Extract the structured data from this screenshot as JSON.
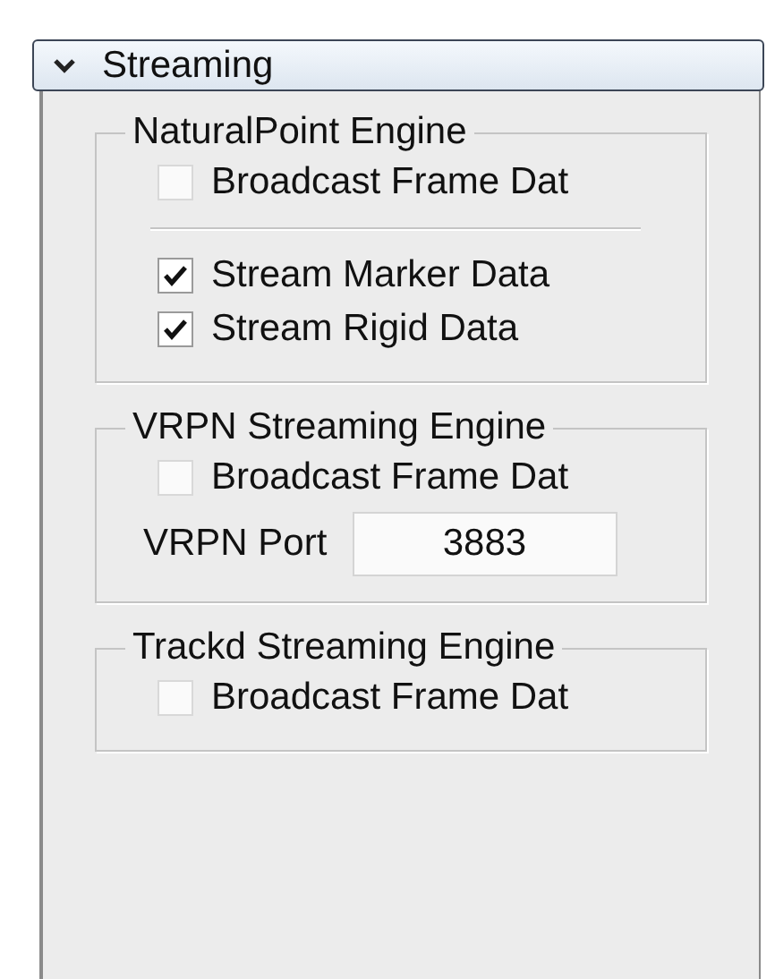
{
  "section": {
    "title": "Streaming",
    "expanded": true,
    "groups": [
      {
        "title": "NaturalPoint Engine",
        "items": [
          {
            "kind": "checkbox",
            "label": "Broadcast Frame Dat",
            "checked": false
          },
          {
            "kind": "separator"
          },
          {
            "kind": "checkbox",
            "label": "Stream Marker Data",
            "checked": true
          },
          {
            "kind": "checkbox",
            "label": "Stream Rigid Data",
            "checked": true
          }
        ]
      },
      {
        "title": "VRPN Streaming Engine",
        "items": [
          {
            "kind": "checkbox",
            "label": "Broadcast Frame Dat",
            "checked": false
          },
          {
            "kind": "field",
            "label": "VRPN Port",
            "value": "3883"
          }
        ]
      },
      {
        "title": "Trackd Streaming Engine",
        "items": [
          {
            "kind": "checkbox",
            "label": "Broadcast Frame Dat",
            "checked": false
          }
        ]
      }
    ]
  }
}
